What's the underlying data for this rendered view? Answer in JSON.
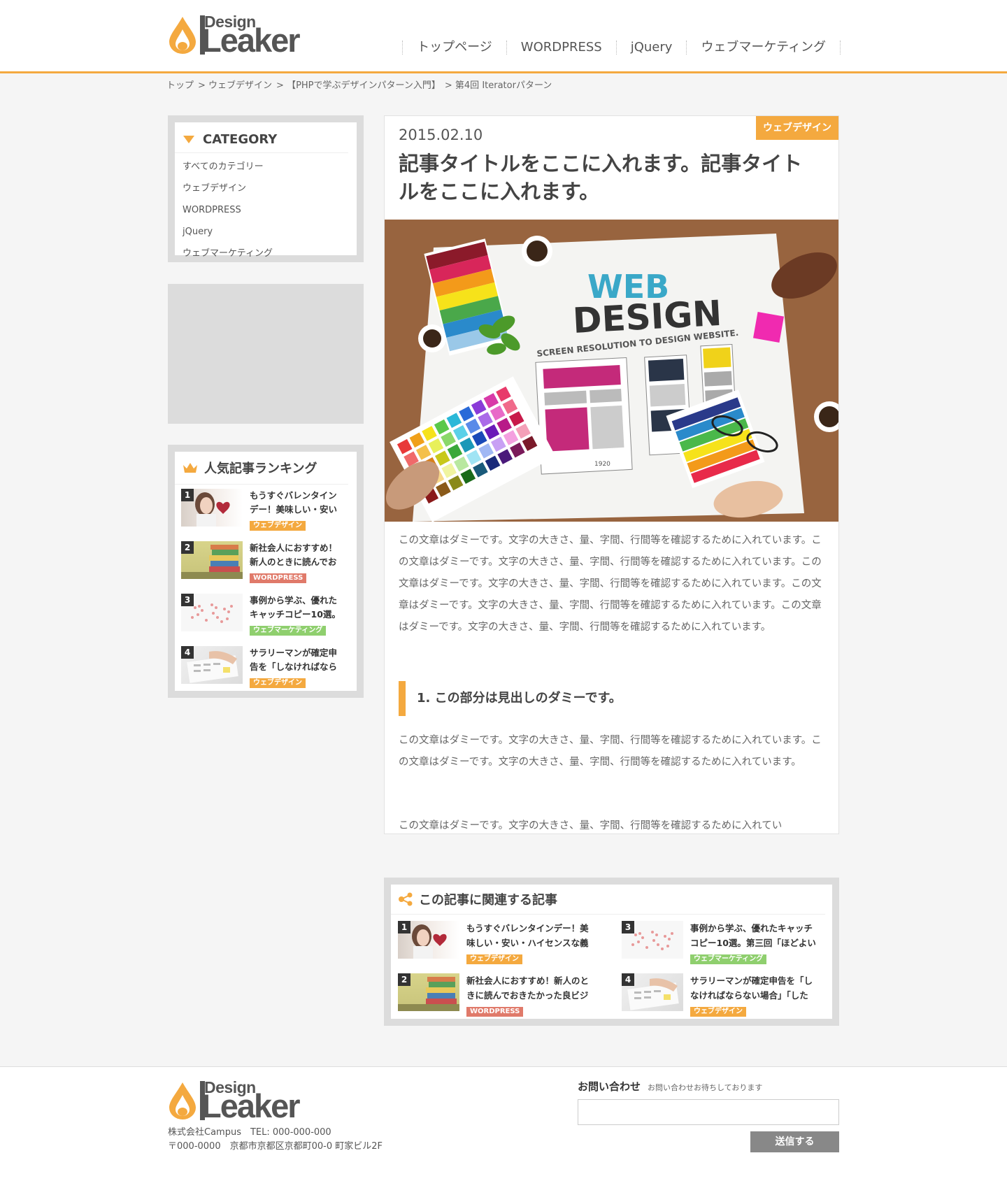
{
  "header": {
    "logo": {
      "top": "Design",
      "bottom": "Leaker"
    },
    "nav": [
      "トップページ",
      "WORDPRESS",
      "jQuery",
      "ウェブマーケティング"
    ]
  },
  "breadcrumb": [
    "トップ",
    "> ウェブデザイン",
    "> 【PHPで学ぶデザインパターン入門】",
    "> 第4回 Iteratorパターン"
  ],
  "sidebar": {
    "category_title": "CATEGORY",
    "categories": [
      "すべてのカテゴリー",
      "ウェブデザイン",
      "WORDPRESS",
      "jQuery",
      "ウェブマーケティング"
    ],
    "ranking_title": "人気記事ランキング",
    "ranking": [
      {
        "num": "1",
        "title": "もうすぐバレンタインデー！美味しい・安い",
        "tag": "ウェブデザイン"
      },
      {
        "num": "2",
        "title": "新社会人におすすめ！新人のときに読んでお",
        "tag": "WORDPRESS"
      },
      {
        "num": "3",
        "title": "事例から学ぶ、優れたキャッチコピー10選。",
        "tag": "ウェブマーケティング"
      },
      {
        "num": "4",
        "title": "サラリーマンが確定申告を「しなければなら",
        "tag": "ウェブデザイン"
      }
    ]
  },
  "article": {
    "tag": "ウェブデザイン",
    "date": "2015.02.10",
    "title": "記事タイトルをここに入れます。記事タイトルをここに入れます。",
    "image_text": {
      "web": "WEB",
      "design": "DESIGN",
      "sub": "SCREEN RESOLUTION TO DESIGN WEBSITE.",
      "width": "1920"
    },
    "body1": "この文章はダミーです。文字の大きさ、量、字間、行間等を確認するために入れています。この文章はダミーです。文字の大きさ、量、字間、行間等を確認するために入れています。この文章はダミーです。文字の大きさ、量、字間、行間等を確認するために入れています。この文章はダミーです。文字の大きさ、量、字間、行間等を確認するために入れています。この文章はダミーです。文字の大きさ、量、字間、行間等を確認するために入れています。",
    "heading": "1. この部分は見出しのダミーです。",
    "body2": "この文章はダミーです。文字の大きさ、量、字間、行間等を確認するために入れています。この文章はダミーです。文字の大きさ、量、字間、行間等を確認するために入れています。",
    "body3": "この文章はダミーです。文字の大きさ、量、字間、行間等を確認するために入れてい"
  },
  "related": {
    "title": "この記事に関連する記事",
    "items": [
      {
        "num": "1",
        "title": "もうすぐバレンタインデー！美味しい・安い・ハイセンスな義",
        "tag": "ウェブデザイン"
      },
      {
        "num": "2",
        "title": "新社会人におすすめ！新人のときに読んでおきたかった良ビジ",
        "tag": "WORDPRESS"
      },
      {
        "num": "3",
        "title": "事例から学ぶ、優れたキャッチコピー10選。第三回「ほどよい",
        "tag": "ウェブマーケティング"
      },
      {
        "num": "4",
        "title": "サラリーマンが確定申告を「しなければならない場合」「した",
        "tag": "ウェブデザイン"
      }
    ]
  },
  "footer": {
    "company": "株式会社Campus　TEL: 000-000-000",
    "address": "〒000-0000　京都市京都区京都町00-0 町家ビル2F",
    "contact_title": "お問い合わせ",
    "contact_sub": "お問い合わせお待ちしております",
    "input_placeholder": "",
    "send": "送信する"
  },
  "colors": {
    "accent": "#f4a93f",
    "wp": "#e07a6a",
    "marketing": "#8fcf6e",
    "gray": "#dcdcdc"
  }
}
